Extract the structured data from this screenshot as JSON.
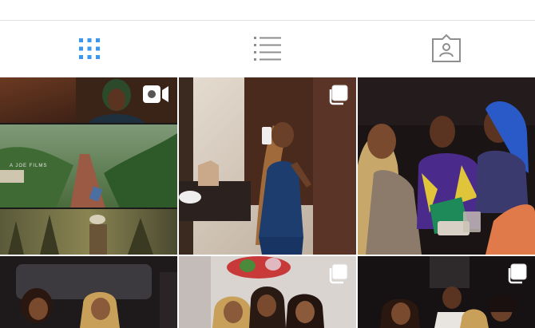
{
  "tabs": [
    {
      "name": "grid",
      "icon": "grid-icon",
      "active": true
    },
    {
      "name": "list",
      "icon": "list-icon",
      "active": false
    },
    {
      "name": "tagged",
      "icon": "tagged-person-icon",
      "active": false
    }
  ],
  "colors": {
    "active_tab": "#3897f0",
    "inactive_tab": "#8e8e8e",
    "divider": "#e2e2e2"
  },
  "posts": [
    {
      "type": "video",
      "badge_icon": "video-camera-icon",
      "overlay_text": "A JOE FILMS"
    },
    {
      "type": "multiple",
      "badge_icon": "multiple-photos-icon"
    },
    {
      "type": "photo"
    },
    {
      "type": "photo"
    },
    {
      "type": "multiple",
      "badge_icon": "multiple-photos-icon"
    },
    {
      "type": "multiple",
      "badge_icon": "multiple-photos-icon"
    }
  ]
}
